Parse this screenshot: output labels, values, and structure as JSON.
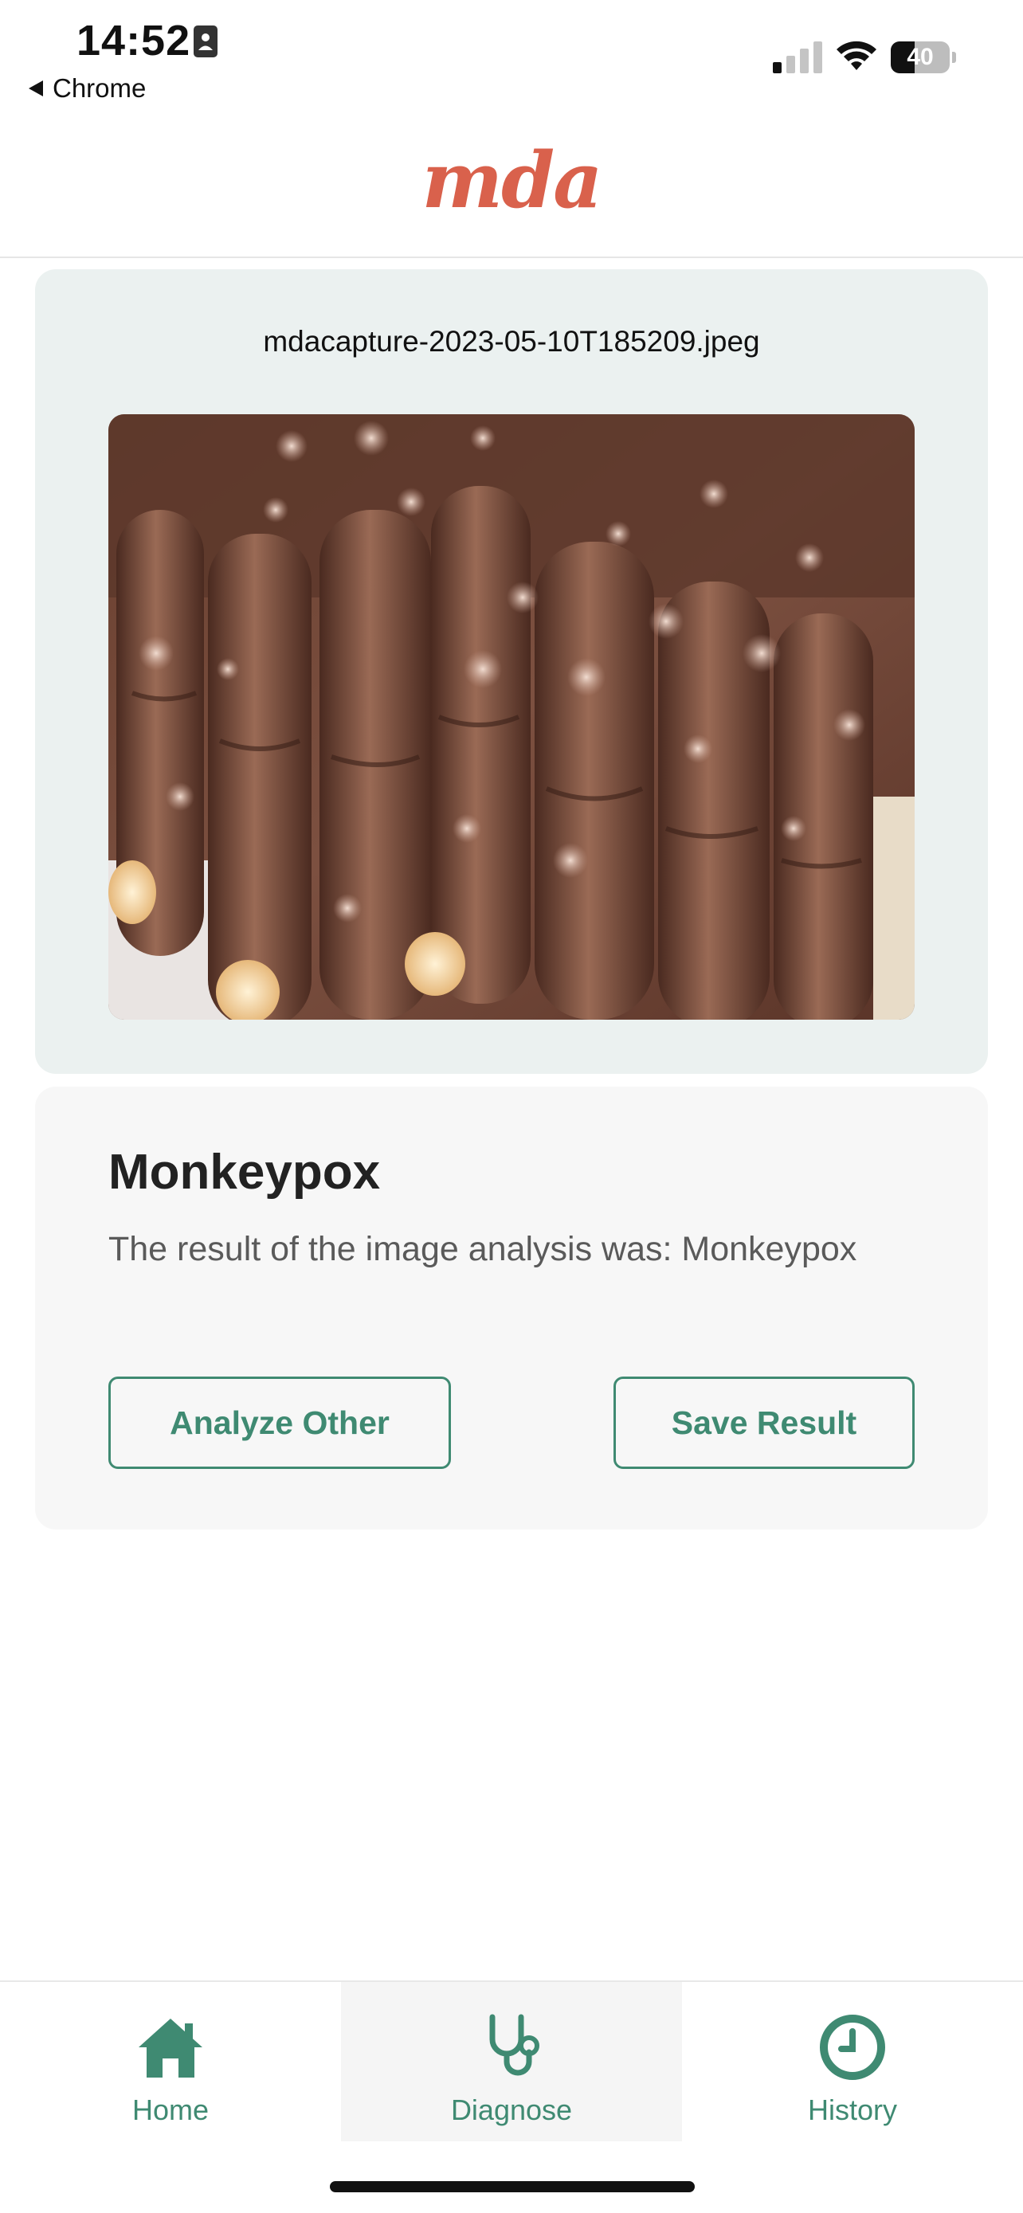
{
  "status_bar": {
    "time": "14:52",
    "back_app": "Chrome",
    "battery_percent": "40",
    "battery_level": 0.4,
    "signal_bars_active": 1
  },
  "header": {
    "logo": "mda"
  },
  "image_card": {
    "file_name": "mdacapture-2023-05-10T185209.jpeg"
  },
  "result": {
    "title": "Monkeypox",
    "description": "The result of the image analysis was: Monkeypox",
    "analyze_other_label": "Analyze Other",
    "save_result_label": "Save Result"
  },
  "nav": {
    "items": [
      {
        "label": "Home",
        "icon": "home-icon",
        "active": false
      },
      {
        "label": "Diagnose",
        "icon": "stethoscope-icon",
        "active": true
      },
      {
        "label": "History",
        "icon": "clock-icon",
        "active": false
      }
    ]
  },
  "colors": {
    "accent": "#3f8a72",
    "logo": "#d9614c",
    "image_card_bg": "#ebf1f0",
    "result_card_bg": "#f7f7f7"
  }
}
